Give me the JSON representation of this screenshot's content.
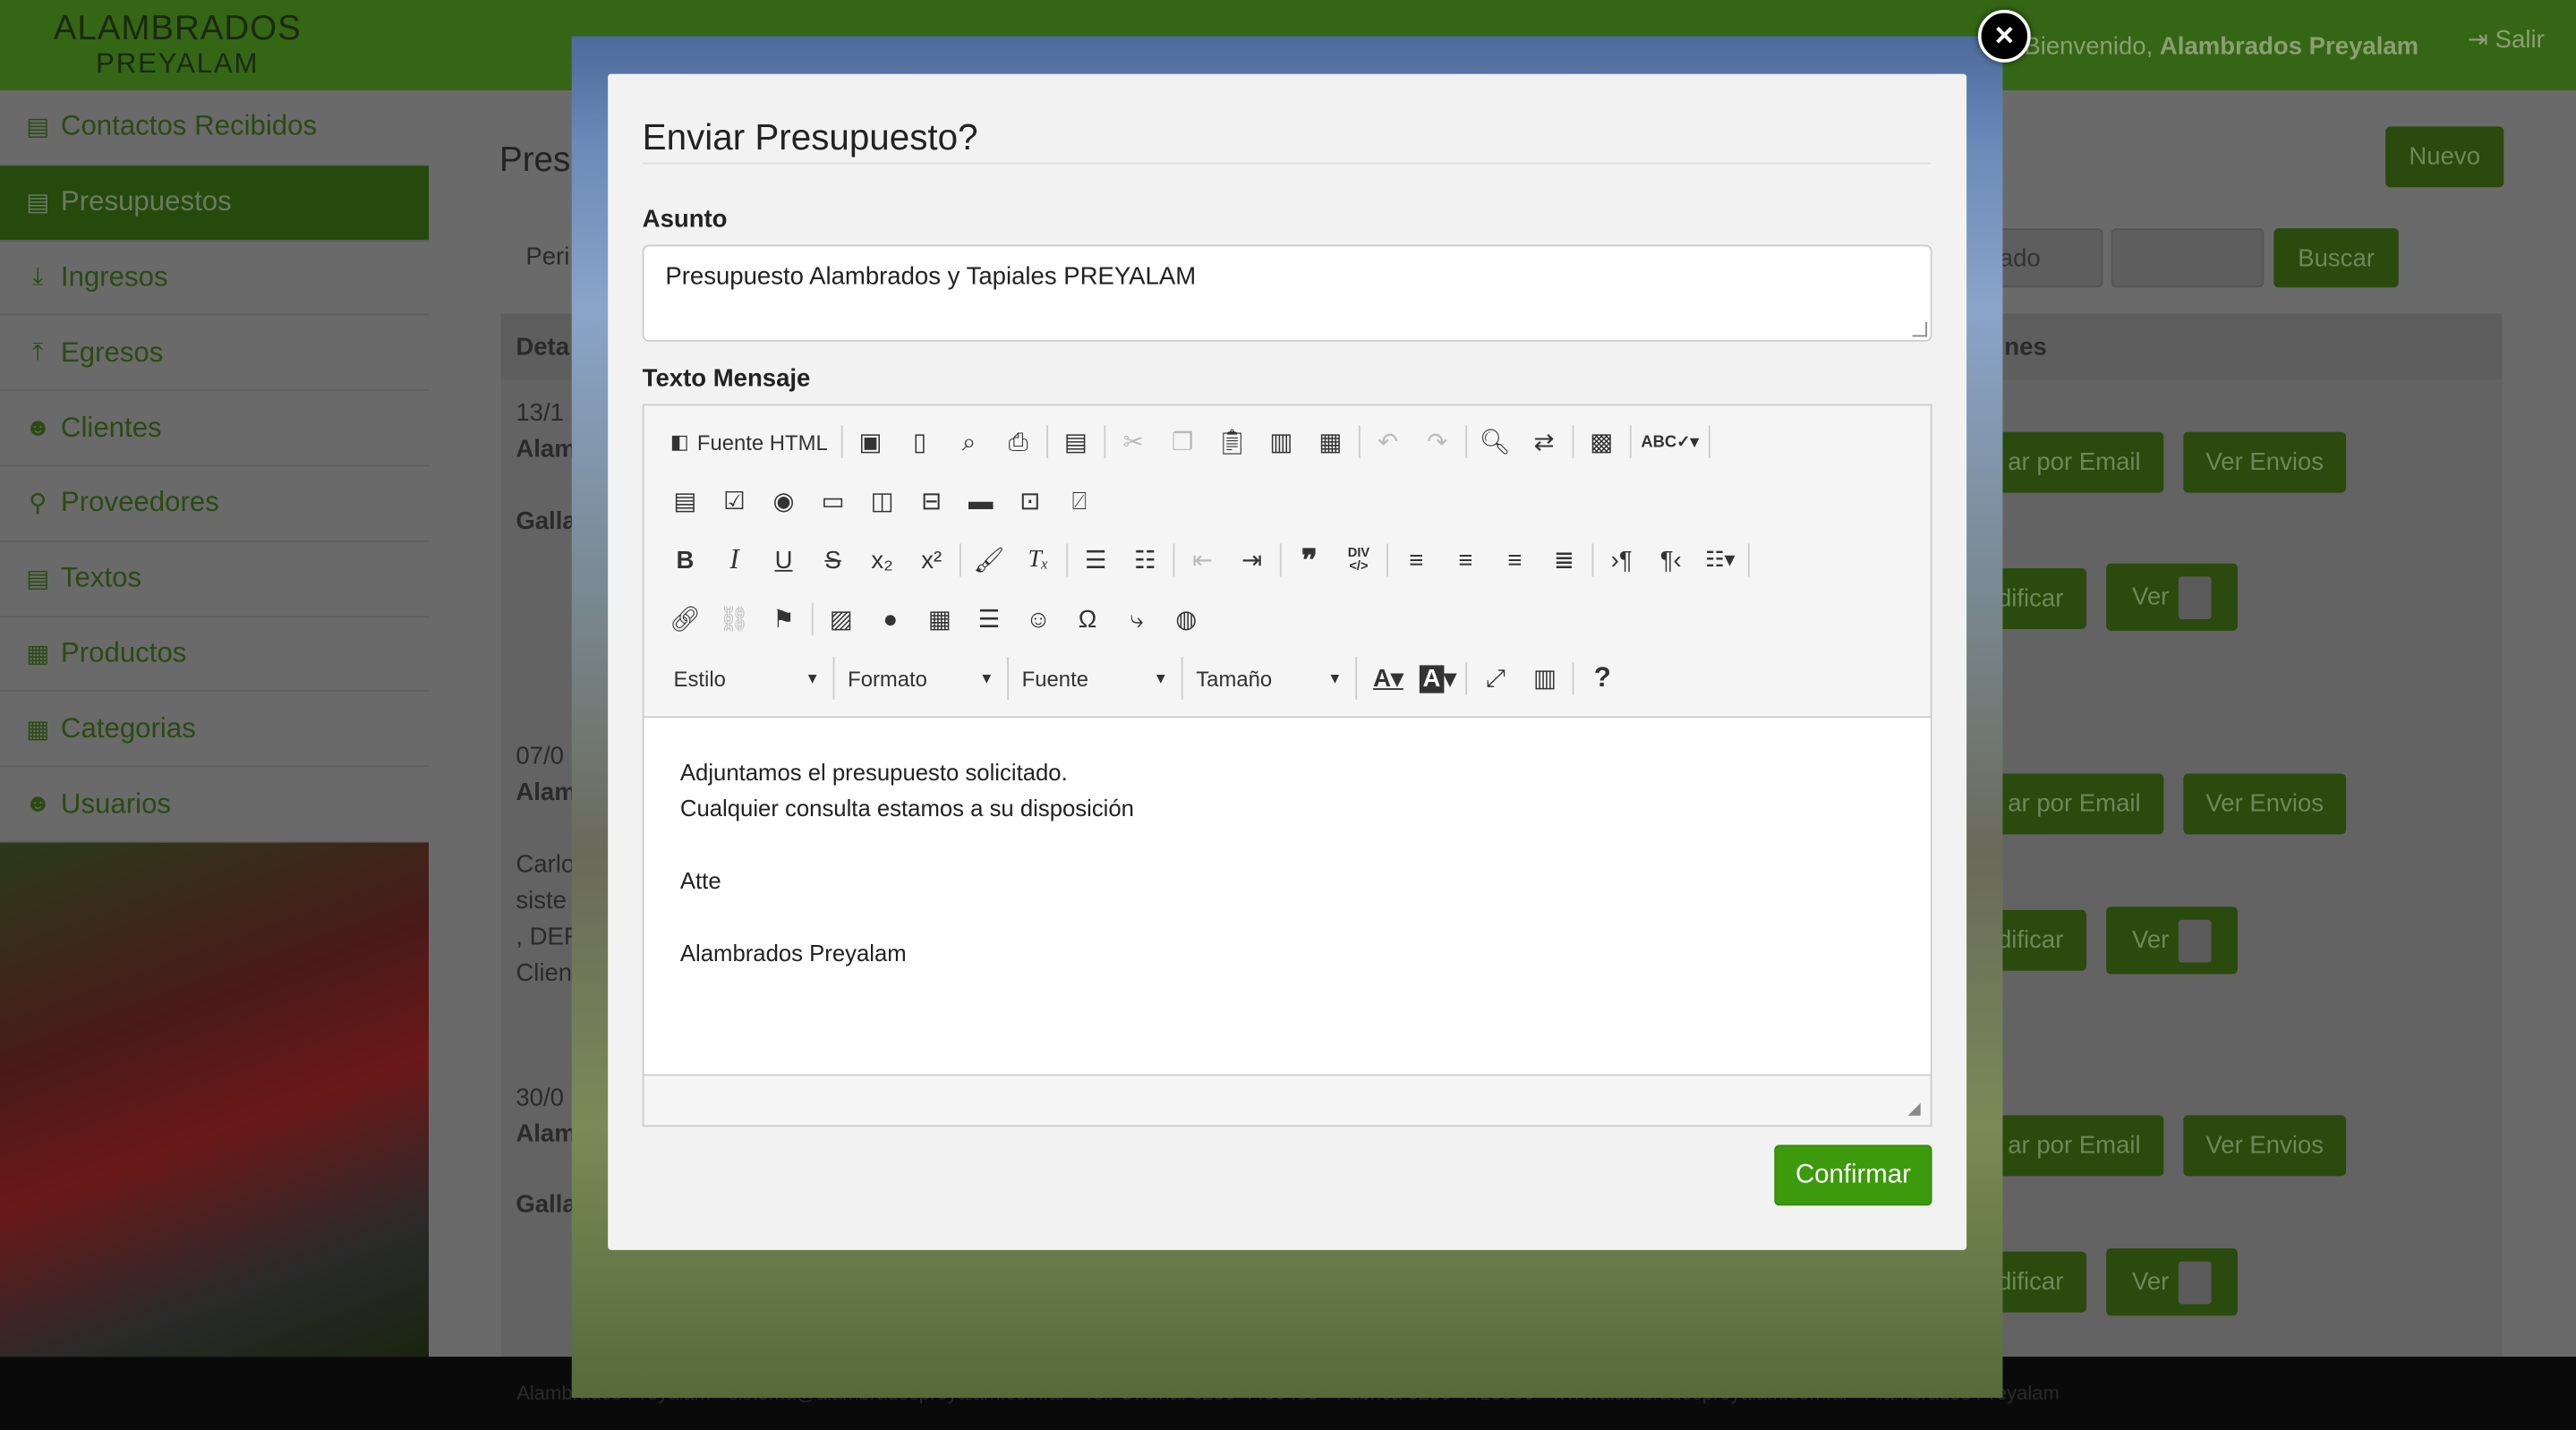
{
  "brand": {
    "line1": "ALAMBRADOS",
    "line2": "PREYALAM"
  },
  "header": {
    "welcome_prefix": "Bienvenido,",
    "welcome_user": "Alambrados Preyalam",
    "logout_label": "Salir"
  },
  "sidebar": {
    "items": [
      {
        "label": "Contactos Recibidos",
        "icon": "document-icon"
      },
      {
        "label": "Presupuestos",
        "icon": "document-icon",
        "active": true
      },
      {
        "label": "Ingresos",
        "icon": "download-icon"
      },
      {
        "label": "Egresos",
        "icon": "upload-icon"
      },
      {
        "label": "Clientes",
        "icon": "users-icon"
      },
      {
        "label": "Proveedores",
        "icon": "bicycle-icon"
      },
      {
        "label": "Textos",
        "icon": "document-icon"
      },
      {
        "label": "Productos",
        "icon": "grid-icon"
      },
      {
        "label": "Categorias",
        "icon": "grid-icon"
      },
      {
        "label": "Usuarios",
        "icon": "users-icon"
      }
    ]
  },
  "background": {
    "page_title": "Pres",
    "new_button": "Nuevo",
    "filter_label": "Peri",
    "select_partial": "ado",
    "search_button": "Buscar",
    "col_detail": "Deta",
    "col_actions": "nes",
    "rows": [
      {
        "date": "13/1",
        "name": "Alam",
        "text": "Galla",
        "text2": "",
        "text3": "",
        "text4": "",
        "send_email": "ar por Email",
        "view_sends": "Ver Envios",
        "edit": "dificar",
        "view": "Ver"
      },
      {
        "date": "07/0",
        "name": "Alam",
        "text": "Carlo",
        "text2": "siste",
        "text3": ", DEF",
        "text4": "Clien",
        "send_email": "ar por Email",
        "view_sends": "Ver Envios",
        "edit": "dificar",
        "view": "Ver"
      },
      {
        "date": "30/0",
        "name": "Alam",
        "text": "Galla",
        "text2": "",
        "text3": "",
        "text4": "",
        "send_email": "ar por Email",
        "view_sends": "Ver Envios",
        "edit": "dificar",
        "view": "Ver"
      }
    ]
  },
  "footer": {
    "text": "Alambrados Preyalam - sistema@alambradospreyalam.com.ar - Tel. Oficina: 0230-4430455 - Fabrica 0230-4428050 - www.alambradospreyalam.com.ar - Alambrados Preyalam"
  },
  "modal": {
    "title": "Enviar Presupuesto?",
    "subject_label": "Asunto",
    "subject_value": "Presupuesto Alambrados y Tapiales PREYALAM",
    "message_label": "Texto Mensaje",
    "source_button": "Fuente HTML",
    "dropdowns": {
      "style": "Estilo",
      "format": "Formato",
      "font": "Fuente",
      "size": "Tamaño"
    },
    "body_lines": [
      "Adjuntamos el presupuesto solicitado.",
      "Cualquier consulta estamos a su disposición",
      "",
      "Atte",
      "",
      "Alambrados Preyalam"
    ],
    "confirm_button": "Confirmar",
    "close_label": "×"
  }
}
